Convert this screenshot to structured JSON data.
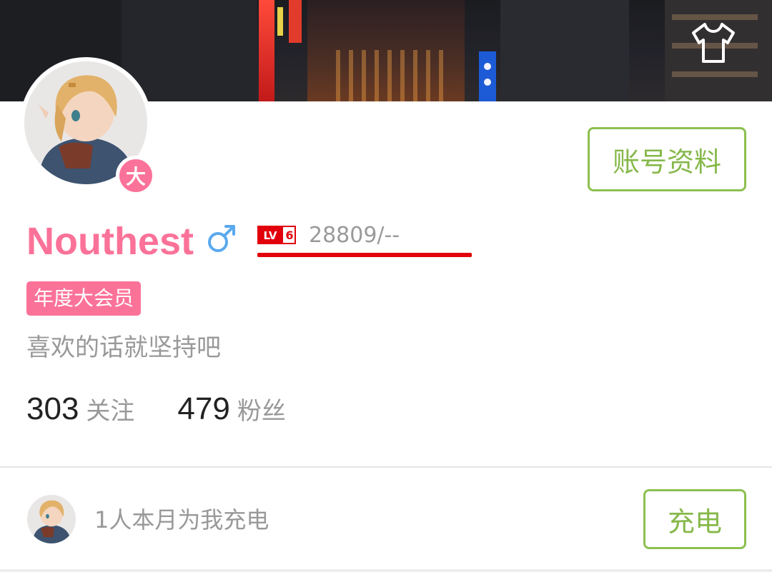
{
  "header": {
    "banner_image": "city-night-street-banner",
    "dress_icon": "tshirt-icon"
  },
  "profile": {
    "avatar_image": "anime-girl-avatar",
    "vip_badge_glyph": "大",
    "edit_button": "账号资料",
    "username": "Nouthest",
    "gender_icon": "male-symbol-icon",
    "level_badge": "LV6",
    "exp_text": "28809/--",
    "exp_progress": 1.0,
    "vip_tag": "年度大会员",
    "signature": "喜欢的话就坚持吧"
  },
  "stats": {
    "following_count": "303",
    "following_label": "关注",
    "followers_count": "479",
    "followers_label": "粉丝"
  },
  "charge": {
    "text": "1人本月为我充电",
    "button": "充电"
  },
  "colors": {
    "pink": "#fb7299",
    "green": "#8dc04f",
    "level_red": "#e1000b",
    "male_blue": "#5aa9ee",
    "gray_text": "#999999"
  }
}
